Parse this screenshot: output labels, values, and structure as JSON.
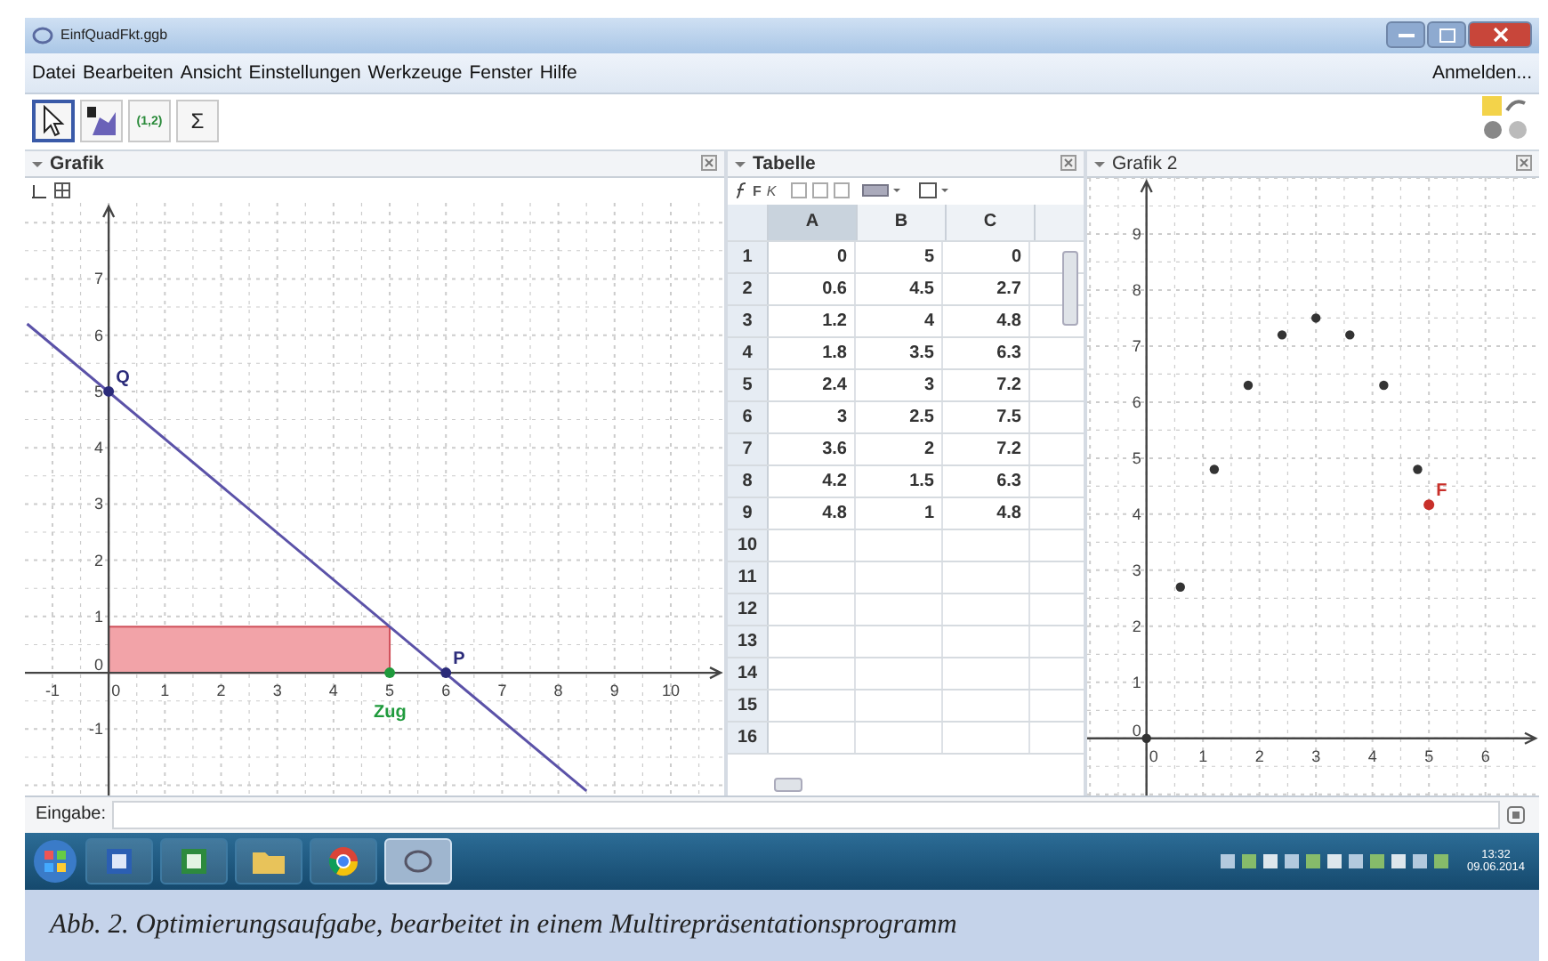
{
  "window": {
    "title": "EinfQuadFkt.ggb"
  },
  "menu": [
    "Datei",
    "Bearbeiten",
    "Ansicht",
    "Einstellungen",
    "Werkzeuge",
    "Fenster",
    "Hilfe"
  ],
  "sign_in": "Anmelden...",
  "toolbar": [
    {
      "kind": "pointer",
      "selected": true
    },
    {
      "kind": "shapes",
      "selected": false
    },
    {
      "kind": "text",
      "label": "(1,2)",
      "selected": false
    },
    {
      "kind": "text",
      "label": "Σ",
      "selected": false
    }
  ],
  "views": [
    {
      "kind": "graphics",
      "title": "Grafik",
      "chart_data": {
        "type": "line",
        "x": [
          -1.45,
          8.5
        ],
        "grid": true,
        "series": [
          {
            "color": "#5b52a8",
            "values": [
              6.2,
              -2.1
            ]
          }
        ],
        "xlim": [
          -1.49,
          10.95
        ],
        "ylim": [
          -2.18,
          8.35
        ],
        "xticks": [
          -1,
          0,
          1,
          2,
          3,
          4,
          5,
          6,
          7,
          8,
          9,
          10
        ],
        "yticks": [
          -1,
          0,
          1,
          2,
          3,
          4,
          5,
          6,
          7
        ],
        "annotations": [
          {
            "text": "Q",
            "x": 0,
            "y": 5
          },
          {
            "text": "P",
            "x": 6,
            "y": 0
          },
          {
            "text": "Zug",
            "x": 5,
            "y": 0
          }
        ]
      }
    },
    {
      "kind": "table",
      "title": "Tabelle",
      "toolbar": [
        "F",
        "K"
      ],
      "columns": [
        "A",
        "B",
        "C"
      ],
      "rows": [
        {
          "number": "1",
          "cells": [
            "0",
            "5",
            "0"
          ]
        },
        {
          "number": "2",
          "cells": [
            "0.6",
            "4.5",
            "2.7"
          ]
        },
        {
          "number": "3",
          "cells": [
            "1.2",
            "4",
            "4.8"
          ]
        },
        {
          "number": "4",
          "cells": [
            "1.8",
            "3.5",
            "6.3"
          ]
        },
        {
          "number": "5",
          "cells": [
            "2.4",
            "3",
            "7.2"
          ]
        },
        {
          "number": "6",
          "cells": [
            "3",
            "2.5",
            "7.5"
          ]
        },
        {
          "number": "7",
          "cells": [
            "3.6",
            "2",
            "7.2"
          ]
        },
        {
          "number": "8",
          "cells": [
            "4.2",
            "1.5",
            "6.3"
          ]
        },
        {
          "number": "9",
          "cells": [
            "4.8",
            "1",
            "4.8"
          ]
        },
        {
          "number": "10",
          "cells": []
        },
        {
          "number": "11",
          "cells": []
        },
        {
          "number": "12",
          "cells": []
        },
        {
          "number": "13",
          "cells": []
        },
        {
          "number": "14",
          "cells": []
        },
        {
          "number": "15",
          "cells": []
        },
        {
          "number": "16",
          "cells": []
        }
      ]
    },
    {
      "kind": "graphics",
      "title": "Grafik 2",
      "chart_data": {
        "type": "scatter",
        "x": [
          0,
          0.6,
          1.2,
          1.8,
          2.4,
          3,
          3.6,
          4.2,
          4.8
        ],
        "grid": true,
        "series": [
          {
            "color": "#333333",
            "values": [
              0,
              2.7,
              4.8,
              6.3,
              7.2,
              7.5,
              7.2,
              6.3,
              4.8
            ]
          }
        ],
        "xlim": [
          -1.05,
          6.95
        ],
        "ylim": [
          -1.02,
          10.0
        ],
        "xticks": [
          0,
          1,
          2,
          3,
          4,
          5,
          6
        ],
        "yticks": [
          0,
          1,
          2,
          3,
          4,
          5,
          6,
          7,
          8,
          9
        ],
        "annotations": [
          {
            "text": "F",
            "x": 5,
            "y": 4.17
          }
        ]
      }
    }
  ],
  "input_bar": {
    "label": "Eingabe:"
  },
  "taskbar": {
    "apps": [
      {
        "kind": "word",
        "selected": false
      },
      {
        "kind": "excel",
        "selected": false
      },
      {
        "kind": "folder",
        "selected": false
      },
      {
        "kind": "chrome",
        "selected": false
      },
      {
        "kind": "geogebra",
        "selected": true
      }
    ],
    "time": "13:32",
    "date": "09.06.2014"
  },
  "caption": "Abb. 2. Optimierungsaufgabe, bearbeitet in einem Multirepräsentationsprogramm"
}
